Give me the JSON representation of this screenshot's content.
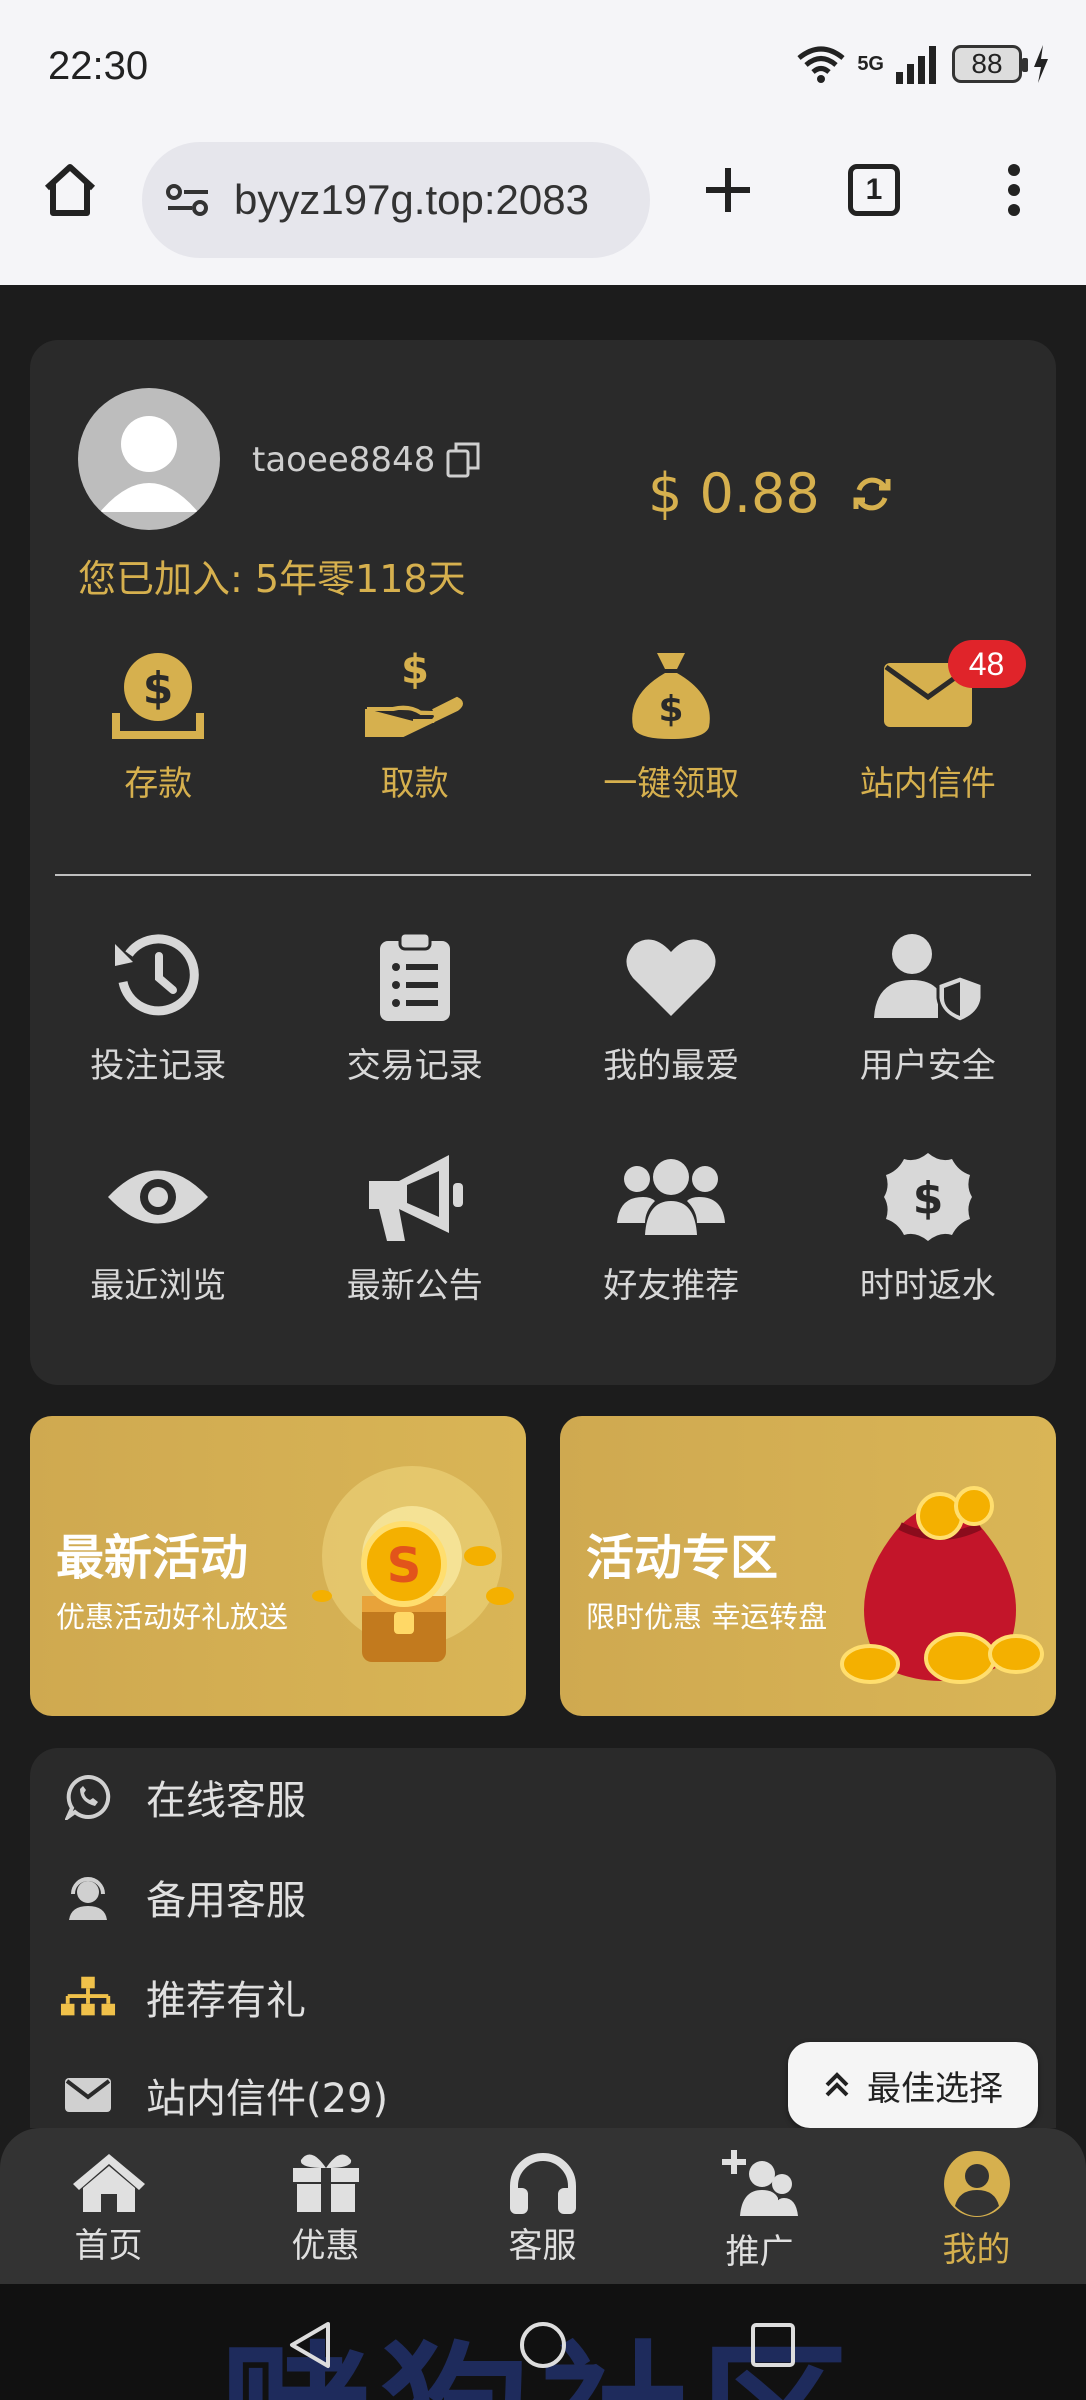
{
  "status_bar": {
    "time": "22:30",
    "network": "5G",
    "battery": "88"
  },
  "browser": {
    "url": "byyz197g.top:2083",
    "tab_count": "1"
  },
  "profile": {
    "username": "taoee8848",
    "balance": "$ 0.88",
    "joined": "您已加入: 5年零118天"
  },
  "quick_actions": [
    {
      "label": "存款",
      "icon": "deposit-icon"
    },
    {
      "label": "取款",
      "icon": "withdraw-icon"
    },
    {
      "label": "一键领取",
      "icon": "money-bag-icon"
    },
    {
      "label": "站内信件",
      "icon": "mail-icon",
      "badge": "48"
    }
  ],
  "grid_row1": [
    {
      "label": "投注记录",
      "icon": "history-icon"
    },
    {
      "label": "交易记录",
      "icon": "clipboard-icon"
    },
    {
      "label": "我的最爱",
      "icon": "heart-icon"
    },
    {
      "label": "用户安全",
      "icon": "user-shield-icon"
    }
  ],
  "grid_row2": [
    {
      "label": "最近浏览",
      "icon": "eye-icon"
    },
    {
      "label": "最新公告",
      "icon": "megaphone-icon"
    },
    {
      "label": "好友推荐",
      "icon": "users-icon"
    },
    {
      "label": "时时返水",
      "icon": "dollar-badge-icon"
    }
  ],
  "banners": [
    {
      "title": "最新活动",
      "subtitle": "优惠活动好礼放送"
    },
    {
      "title": "活动专区",
      "subtitle": "限时优惠 幸运转盘"
    }
  ],
  "menu": [
    {
      "label": "在线客服",
      "icon": "whatsapp-icon"
    },
    {
      "label": "备用客服",
      "icon": "headset-user-icon"
    },
    {
      "label": "推荐有礼",
      "icon": "sitemap-icon"
    },
    {
      "label": "站内信件(29)",
      "icon": "envelope-icon"
    }
  ],
  "floating_button": "最佳选择",
  "bottom_nav": [
    {
      "label": "首页",
      "icon": "home-icon"
    },
    {
      "label": "优惠",
      "icon": "gift-icon"
    },
    {
      "label": "客服",
      "icon": "headphones-icon"
    },
    {
      "label": "推广",
      "icon": "user-plus-icon"
    },
    {
      "label": "我的",
      "icon": "user-circle-icon",
      "active": true
    }
  ],
  "watermark": "赌狗社区",
  "colors": {
    "gold": "#d6b04e",
    "card": "#2a2a2a",
    "background": "#1c1c1c",
    "badge": "#e0242a"
  }
}
